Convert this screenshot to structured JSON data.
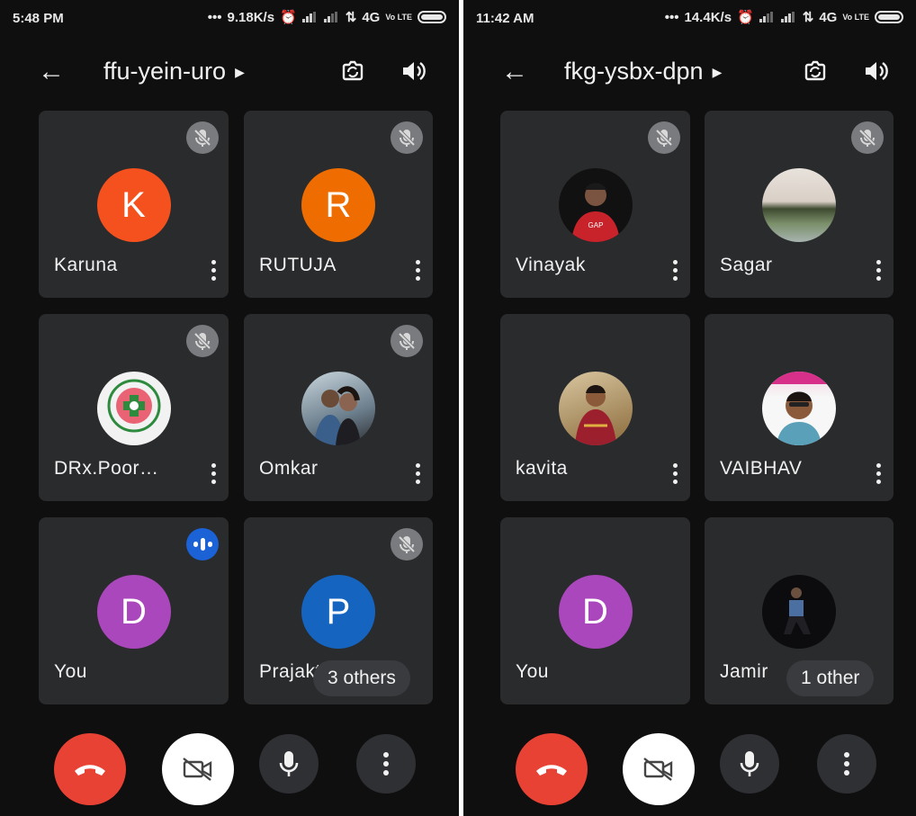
{
  "panels": [
    {
      "status": {
        "time": "5:48 PM",
        "speed": "9.18K/s",
        "network": "4G",
        "volte": "Vo LTE"
      },
      "meeting_code": "ffu-yein-uro",
      "tiles": [
        {
          "initial": "K",
          "name": "Karuna",
          "color": "#f4511e",
          "muted": true
        },
        {
          "initial": "R",
          "name": "RUTUJA",
          "color": "#ef6c00",
          "muted": true
        },
        {
          "initial": "",
          "name": "DRx.Poor…",
          "photo": "pharmacist-logo",
          "muted": true
        },
        {
          "initial": "",
          "name": "Omkar",
          "photo": "couple-photo",
          "muted": true
        },
        {
          "initial": "D",
          "name": "You",
          "color": "#ab47bc",
          "speaking": true
        },
        {
          "initial": "P",
          "name": "Prajakt",
          "color": "#1565c0",
          "muted": true
        }
      ],
      "others_label": "3 others"
    },
    {
      "status": {
        "time": "11:42 AM",
        "speed": "14.4K/s",
        "network": "4G",
        "volte": "Vo LTE"
      },
      "meeting_code": "fkg-ysbx-dpn",
      "tiles": [
        {
          "initial": "",
          "name": "Vinayak",
          "photo": "person-red-hoodie",
          "muted": true
        },
        {
          "initial": "",
          "name": "Sagar",
          "photo": "lake-sunset",
          "muted": true
        },
        {
          "initial": "",
          "name": "kavita",
          "photo": "woman-saree",
          "muted": false
        },
        {
          "initial": "",
          "name": "VAIBHAV",
          "photo": "man-selfie",
          "muted": false
        },
        {
          "initial": "D",
          "name": "You",
          "color": "#ab47bc",
          "speaking": false
        },
        {
          "initial": "",
          "name": "Jamir",
          "photo": "dark-portrait",
          "muted": false
        }
      ],
      "others_label": "1 other"
    }
  ],
  "colors": {
    "hangup": "#e84235",
    "mute_badge": "#7a7b7e",
    "speaking_badge": "#1a62d6",
    "tile_bg": "#2a2b2d"
  },
  "icons": [
    "back-arrow-icon",
    "switch-camera-icon",
    "speaker-icon",
    "mic-off-icon",
    "more-vert-icon",
    "hang-up-icon",
    "camera-off-icon",
    "mic-icon",
    "voice-activity-icon"
  ]
}
